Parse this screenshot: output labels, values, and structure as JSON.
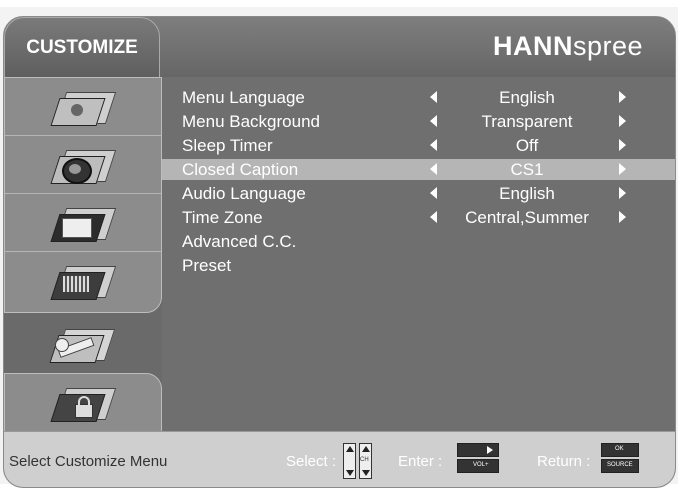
{
  "header": {
    "title": "CUSTOMIZE",
    "brand_bold": "HANN",
    "brand_light": "spree"
  },
  "sidebar": {
    "items": [
      {
        "icon": "person-icon"
      },
      {
        "icon": "speaker-icon"
      },
      {
        "icon": "picture-icon"
      },
      {
        "icon": "film-icon"
      },
      {
        "icon": "wrench-icon"
      },
      {
        "icon": "lock-icon"
      }
    ],
    "selected_index": 4
  },
  "menu": {
    "rows": [
      {
        "label": "Menu Language",
        "value": "English",
        "arrows": true
      },
      {
        "label": "Menu Background",
        "value": "Transparent",
        "arrows": true
      },
      {
        "label": "Sleep Timer",
        "value": "Off",
        "arrows": true
      },
      {
        "label": "Closed Caption",
        "value": "CS1",
        "arrows": true,
        "selected": true
      },
      {
        "label": "Audio Language",
        "value": "English",
        "arrows": true
      },
      {
        "label": "Time Zone",
        "value": "Central,Summer",
        "arrows": true
      },
      {
        "label": "Advanced C.C.",
        "value": "",
        "arrows": false
      },
      {
        "label": "Preset",
        "value": "",
        "arrows": false
      }
    ]
  },
  "footer": {
    "hint": "Select Customize Menu",
    "select_label": "Select :",
    "ch_label": "CH",
    "enter_label": "Enter :",
    "vol_label": "VOL+",
    "return_label": "Return :",
    "ok_label": "OK",
    "source_label": "SOURCE"
  },
  "colors": {
    "panel": "#6f6f6f",
    "highlight": "#b5b5b5",
    "footer": "#cfcfcf"
  }
}
